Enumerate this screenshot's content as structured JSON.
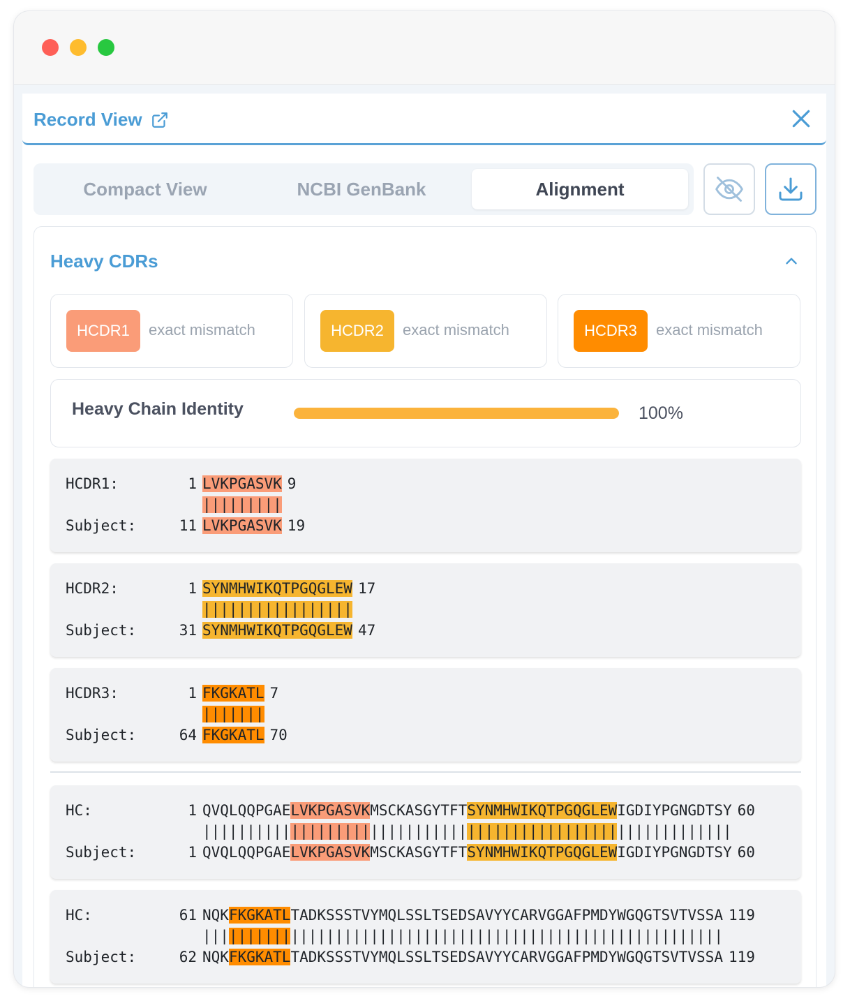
{
  "window": {
    "controls": [
      "close",
      "minimize",
      "zoom"
    ]
  },
  "header": {
    "title": "Record View"
  },
  "tabs": [
    {
      "label": "Compact View",
      "active": false
    },
    {
      "label": "NCBI GenBank",
      "active": false
    },
    {
      "label": "Alignment",
      "active": true
    }
  ],
  "toolbar": {
    "hide_icon": "eye-off-icon",
    "download_icon": "download-icon"
  },
  "cdr_section": {
    "title": "Heavy CDRs",
    "badges": [
      {
        "label": "HCDR1",
        "status": "exact mismatch",
        "color": "#fa9c78"
      },
      {
        "label": "HCDR2",
        "status": "exact mismatch",
        "color": "#f6b52f"
      },
      {
        "label": "HCDR3",
        "status": "exact mismatch",
        "color": "#ff8c00"
      }
    ],
    "identity": {
      "label": "Heavy Chain Identity",
      "value_text": "100%",
      "value": 1.0
    }
  },
  "alignments": [
    {
      "query_label": "HCDR1:",
      "query_start": "1",
      "query_end": "9",
      "subject_label": "Subject:",
      "subject_start": "11",
      "subject_end": "19",
      "segments": [
        {
          "query": "LVKPGASVK",
          "match": "|||||||||",
          "subject": "LVKPGASVK",
          "hl": "h1"
        }
      ]
    },
    {
      "query_label": "HCDR2:",
      "query_start": "1",
      "query_end": "17",
      "subject_label": "Subject:",
      "subject_start": "31",
      "subject_end": "47",
      "segments": [
        {
          "query": "SYNMHWIKQTPGQGLEW",
          "match": "|||||||||||||||||",
          "subject": "SYNMHWIKQTPGQGLEW",
          "hl": "h2"
        }
      ]
    },
    {
      "query_label": "HCDR3:",
      "query_start": "1",
      "query_end": "7",
      "subject_label": "Subject:",
      "subject_start": "64",
      "subject_end": "70",
      "segments": [
        {
          "query": "FKGKATL",
          "match": "|||||||",
          "subject": "FKGKATL",
          "hl": "h3"
        }
      ]
    },
    {
      "query_label": "HC:",
      "query_start": "1",
      "query_end": "60",
      "subject_label": "Subject:",
      "subject_start": "1",
      "subject_end": "60",
      "segments": [
        {
          "query": "QVQLQQPGAE",
          "match": "||||||||||",
          "subject": "QVQLQQPGAE",
          "hl": ""
        },
        {
          "query": "LVKPGASVK",
          "match": "|||||||||",
          "subject": "LVKPGASVK",
          "hl": "h1"
        },
        {
          "query": "MSCKASGYTFT",
          "match": "|||||||||||",
          "subject": "MSCKASGYTFT",
          "hl": ""
        },
        {
          "query": "SYNMHWIKQTPGQGLEW",
          "match": "|||||||||||||||||",
          "subject": "SYNMHWIKQTPGQGLEW",
          "hl": "h2"
        },
        {
          "query": "IGDIYPGNGDTSY",
          "match": "|||||||||||||",
          "subject": "IGDIYPGNGDTSY",
          "hl": ""
        }
      ]
    },
    {
      "query_label": "HC:",
      "query_start": "61",
      "query_end": "119",
      "subject_label": "Subject:",
      "subject_start": "62",
      "subject_end": "119",
      "segments": [
        {
          "query": "NQK",
          "match": "|||",
          "subject": "NQK",
          "hl": ""
        },
        {
          "query": "FKGKATL",
          "match": "|||||||",
          "subject": "FKGKATL",
          "hl": "h3"
        },
        {
          "query": "TADKSSSTVYMQLSSLTSEDSAVYYCARVGGAFPMDYWGQGTSVTVSSA",
          "match": "|||||||||||||||||||||||||||||||||||||||||||||||||",
          "subject": "TADKSSSTVYMQLSSLTSEDSAVYYCARVGGAFPMDYWGQGTSVTVSSA",
          "hl": ""
        }
      ]
    }
  ]
}
